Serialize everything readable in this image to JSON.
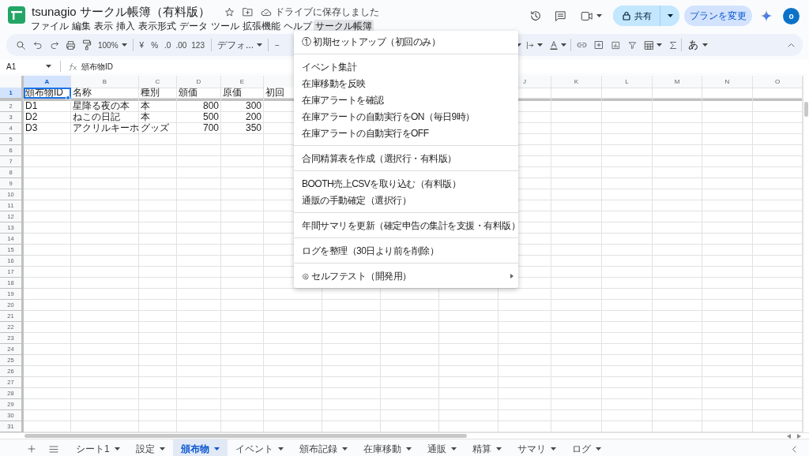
{
  "document": {
    "title": "tsunagio サークル帳簿（有料版）",
    "save_status": "ドライブに保存しました"
  },
  "menubar": [
    {
      "label": "ファイル",
      "selected": false
    },
    {
      "label": "編集",
      "selected": false
    },
    {
      "label": "表示",
      "selected": false
    },
    {
      "label": "挿入",
      "selected": false
    },
    {
      "label": "表示形式",
      "selected": false
    },
    {
      "label": "データ",
      "selected": false
    },
    {
      "label": "ツール",
      "selected": false
    },
    {
      "label": "拡張機能",
      "selected": false
    },
    {
      "label": "ヘルプ",
      "selected": false
    },
    {
      "label": "サークル帳簿",
      "selected": true
    }
  ],
  "header_actions": {
    "share": "共有",
    "upgrade": "プランを変更",
    "avatar": "o"
  },
  "toolbar": {
    "zoom": "100%",
    "currency": "¥",
    "percent": "%",
    "decrease_decimals": ".0",
    "increase_decimals": ".00",
    "number_format": "123",
    "font": "デフォ...",
    "font_size_minus": "−",
    "input_tool": "あ"
  },
  "formula_bar": {
    "cell": "A1",
    "value": "頒布物ID"
  },
  "grid": {
    "columns_left": [
      {
        "letter": "A",
        "selected": true
      },
      {
        "letter": "B",
        "selected": false
      },
      {
        "letter": "C",
        "selected": false
      },
      {
        "letter": "D",
        "selected": false
      },
      {
        "letter": "E",
        "selected": false
      }
    ],
    "columns_right": [
      {
        "letter": "J",
        "selected": false
      },
      {
        "letter": "K",
        "selected": false
      },
      {
        "letter": "L",
        "selected": false
      },
      {
        "letter": "M",
        "selected": false
      },
      {
        "letter": "N",
        "selected": false
      },
      {
        "letter": "O",
        "selected": false
      }
    ],
    "rows": [
      {
        "number": "1",
        "selected": true,
        "cells": [
          {
            "text": "頒布物ID",
            "kind": "text",
            "selected": true
          },
          {
            "text": "名称",
            "kind": "text",
            "selected": false
          },
          {
            "text": "種別",
            "kind": "text",
            "selected": false
          },
          {
            "text": "頒価",
            "kind": "text",
            "selected": false
          },
          {
            "text": "原価",
            "kind": "text",
            "selected": false
          },
          {
            "text": "初回",
            "kind": "text",
            "selected": false
          }
        ]
      },
      {
        "number": "2",
        "selected": false,
        "cells": [
          {
            "text": "D1",
            "kind": "text",
            "selected": false
          },
          {
            "text": "星降る夜の本",
            "kind": "text",
            "selected": false
          },
          {
            "text": "本",
            "kind": "text",
            "selected": false
          },
          {
            "text": "800",
            "kind": "number",
            "selected": false
          },
          {
            "text": "300",
            "kind": "number",
            "selected": false
          }
        ]
      },
      {
        "number": "3",
        "selected": false,
        "cells": [
          {
            "text": "D2",
            "kind": "text",
            "selected": false
          },
          {
            "text": "ねこの日記",
            "kind": "text",
            "selected": false
          },
          {
            "text": "本",
            "kind": "text",
            "selected": false
          },
          {
            "text": "500",
            "kind": "number",
            "selected": false
          },
          {
            "text": "200",
            "kind": "number",
            "selected": false
          }
        ]
      },
      {
        "number": "4",
        "selected": false,
        "cells": [
          {
            "text": "D3",
            "kind": "text",
            "selected": false
          },
          {
            "text": "アクリルキーホ",
            "kind": "text",
            "selected": false
          },
          {
            "text": "グッズ",
            "kind": "text",
            "selected": false
          },
          {
            "text": "700",
            "kind": "number",
            "selected": false
          },
          {
            "text": "350",
            "kind": "number",
            "selected": false
          }
        ]
      },
      {
        "number": "5",
        "selected": false
      },
      {
        "number": "6",
        "selected": false
      },
      {
        "number": "7",
        "selected": false
      },
      {
        "number": "8",
        "selected": false
      },
      {
        "number": "9",
        "selected": false
      },
      {
        "number": "10",
        "selected": false
      },
      {
        "number": "11",
        "selected": false
      },
      {
        "number": "12",
        "selected": false
      },
      {
        "number": "13",
        "selected": false
      },
      {
        "number": "14",
        "selected": false
      },
      {
        "number": "15",
        "selected": false
      },
      {
        "number": "16",
        "selected": false
      },
      {
        "number": "17",
        "selected": false
      },
      {
        "number": "18",
        "selected": false
      },
      {
        "number": "19",
        "selected": false
      },
      {
        "number": "20",
        "selected": false
      },
      {
        "number": "21",
        "selected": false
      },
      {
        "number": "22",
        "selected": false
      },
      {
        "number": "23",
        "selected": false
      },
      {
        "number": "24",
        "selected": false
      },
      {
        "number": "25",
        "selected": false
      },
      {
        "number": "26",
        "selected": false
      },
      {
        "number": "27",
        "selected": false
      },
      {
        "number": "28",
        "selected": false
      },
      {
        "number": "29",
        "selected": false
      },
      {
        "number": "30",
        "selected": false
      },
      {
        "number": "31",
        "selected": false
      }
    ]
  },
  "menu": {
    "items": [
      {
        "kind": "item",
        "label": "① 初期セットアップ（初回のみ）",
        "submenu": false
      },
      {
        "kind": "separator"
      },
      {
        "kind": "item",
        "label": "イベント集計",
        "submenu": false
      },
      {
        "kind": "item",
        "label": "在庫移動を反映",
        "submenu": false
      },
      {
        "kind": "item",
        "label": "在庫アラートを確認",
        "submenu": false
      },
      {
        "kind": "item",
        "label": "在庫アラートの自動実行をON（毎日9時）",
        "submenu": false
      },
      {
        "kind": "item",
        "label": "在庫アラートの自動実行をOFF",
        "submenu": false
      },
      {
        "kind": "separator"
      },
      {
        "kind": "item",
        "label": "合同精算表を作成（選択行・有料版）",
        "submenu": false
      },
      {
        "kind": "separator"
      },
      {
        "kind": "item",
        "label": "BOOTH売上CSVを取り込む（有料版）",
        "submenu": false
      },
      {
        "kind": "item",
        "label": "通販の手動確定（選択行）",
        "submenu": false
      },
      {
        "kind": "separator"
      },
      {
        "kind": "item",
        "label": "年間サマリを更新（確定申告の集計を支援・有料版）",
        "submenu": false
      },
      {
        "kind": "separator"
      },
      {
        "kind": "item",
        "label": "ログを整理（30日より前を削除）",
        "submenu": false
      },
      {
        "kind": "separator"
      },
      {
        "kind": "item",
        "label": "⊙ セルフテスト（開発用）",
        "submenu": true
      }
    ]
  },
  "sheet_tabs": [
    {
      "label": "シート1",
      "selected": false
    },
    {
      "label": "設定",
      "selected": false
    },
    {
      "label": "頒布物",
      "selected": true
    },
    {
      "label": "イベント",
      "selected": false
    },
    {
      "label": "頒布記録",
      "selected": false
    },
    {
      "label": "在庫移動",
      "selected": false
    },
    {
      "label": "通販",
      "selected": false
    },
    {
      "label": "精算",
      "selected": false
    },
    {
      "label": "サマリ",
      "selected": false
    },
    {
      "label": "ログ",
      "selected": false
    }
  ]
}
